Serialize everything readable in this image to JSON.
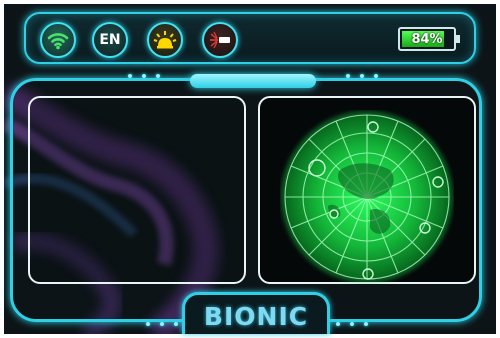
{
  "status_bar": {
    "buttons": [
      {
        "id": "wifi",
        "icon": "wifi-icon",
        "color": "#4be26a"
      },
      {
        "id": "language",
        "icon": "language-icon",
        "label": "EN"
      },
      {
        "id": "light",
        "icon": "flashlight-icon",
        "color": "#ffd800"
      },
      {
        "id": "laser",
        "icon": "laser-icon",
        "color": "#e83a3a"
      }
    ],
    "battery": {
      "label": "84%",
      "level": 0.84,
      "icon": "battery-icon"
    }
  },
  "panels": {
    "left": {
      "name": "display-panel-left"
    },
    "right": {
      "name": "radar-panel",
      "icon": "radar-icon",
      "accent": "#22e85a"
    }
  },
  "brand": {
    "text": "BIONIC"
  },
  "colors": {
    "accent": "#2fd0e6",
    "background": "#0c1417"
  }
}
